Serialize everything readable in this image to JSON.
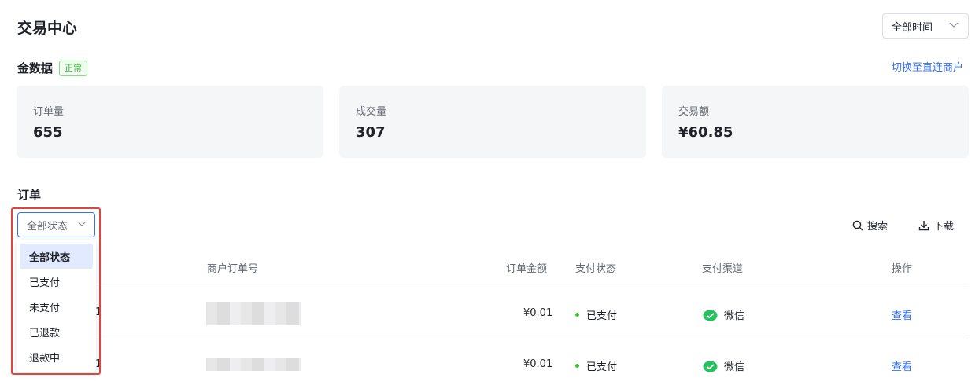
{
  "header": {
    "title": "交易中心",
    "time_filter": "全部时间"
  },
  "data_section": {
    "title": "金数据",
    "badge": "正常",
    "switch_link": "切换至直连商户"
  },
  "cards": [
    {
      "label": "订单量",
      "value": "655"
    },
    {
      "label": "成交量",
      "value": "307"
    },
    {
      "label": "交易额",
      "value": "¥60.85"
    }
  ],
  "orders": {
    "title": "订单",
    "status_filter": "全部状态",
    "status_options": [
      "全部状态",
      "已支付",
      "未支付",
      "已退款",
      "退款中"
    ],
    "search_label": "搜索",
    "download_label": "下载",
    "columns": [
      "商户订单号",
      "订单金额",
      "支付状态",
      "支付渠道",
      "操作"
    ],
    "rows": [
      {
        "amount": "¥0.01",
        "status": "已支付",
        "channel": "微信",
        "action": "查看",
        "row_prefix": "1"
      },
      {
        "amount": "¥0.01",
        "status": "已支付",
        "channel": "微信",
        "action": "查看",
        "row_prefix": "1"
      }
    ]
  },
  "colors": {
    "accent": "#3370ff",
    "success": "#34c724",
    "highlight": "#e0443c"
  },
  "icons": [
    "chevron-down-icon",
    "search-icon",
    "download-icon",
    "wechat-icon"
  ]
}
